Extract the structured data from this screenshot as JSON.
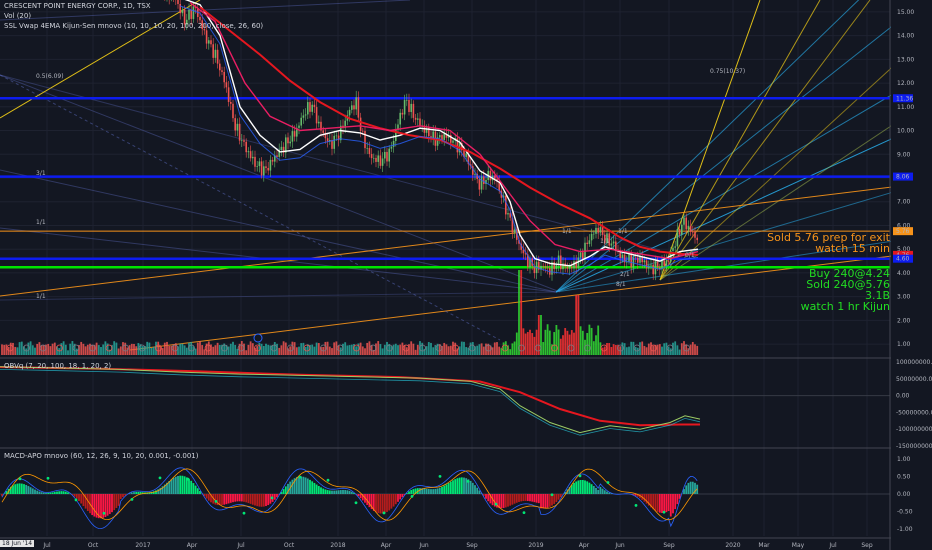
{
  "header": {
    "title": "CRESCENT POINT ENERGY CORP., 1D, TSX",
    "vol": "Vol (20)",
    "indicator": "SSL Vwap 4EMA Kijun-Sen mnovo (10, 10, 10, 20, 100, 200, close, 26, 60)"
  },
  "panes": {
    "obv": "OBVq (7, 20, 100, 18, 1, 20, 2)",
    "macd": "MACD-APO mnovo (60, 12, 26, 9, 10, 20, 0.001, -0.001)"
  },
  "annotations": [
    {
      "text": "Sold 5.76 prep for exit",
      "color": "#f7931a"
    },
    {
      "text": "watch 15 min",
      "color": "#f7931a"
    },
    {
      "text": "Buy 240@4.24",
      "color": "#22dd22"
    },
    {
      "text": "Sold 240@5.76",
      "color": "#22dd22"
    },
    {
      "text": "3.1B",
      "color": "#22dd22"
    },
    {
      "text": "watch 1 hr Kijun",
      "color": "#22dd22"
    }
  ],
  "fib_labels": [
    "0.75(10.37)",
    "0.5(6.09)",
    "3/1",
    "1/1",
    "1/1",
    "1/1",
    "1/1",
    "0/1",
    "2/1",
    "8/1",
    "1/1"
  ],
  "date_flag": "18 Jun '14",
  "colors": {
    "background": "#131722",
    "price": "#e0e0e0",
    "ma_red": "#e5171f",
    "ma_white": "#ffffff",
    "ma_magenta": "#e91e63",
    "ma_blue": "#2962ff",
    "blue_level": "#0d1cf0",
    "green_level": "#00e600",
    "orange": "#f7931a",
    "yellow": "#f5d016",
    "cyan": "#29b6f6"
  },
  "chart_data": [
    {
      "type": "line",
      "pane": "price",
      "x_ticks": [
        "Jul",
        "Oct",
        "2017",
        "Apr",
        "Jul",
        "Oct",
        "2018",
        "Apr",
        "Jun",
        "Sep",
        "2019",
        "Apr",
        "Jun",
        "Sep",
        "2020",
        "Mar",
        "May",
        "Jul",
        "Sep"
      ],
      "ylim": [
        0.5,
        15.5
      ],
      "y_ticks": [
        1.0,
        2.0,
        3.0,
        4.0,
        5.0,
        6.0,
        7.0,
        8.0,
        9.0,
        10.0,
        11.0,
        12.0,
        13.0,
        14.0,
        15.0
      ],
      "price_tags": [
        {
          "value": 11.36,
          "label": "11.36",
          "color": "#0d1cf0"
        },
        {
          "value": 8.06,
          "label": "8.06",
          "color": "#0d1cf0"
        },
        {
          "value": 5.76,
          "label": "5.76",
          "color": "#f7931a"
        },
        {
          "value": 4.76,
          "label": "4.76",
          "color": "#e5171f"
        },
        {
          "value": 4.6,
          "label": "4.60",
          "color": "#0d1cf0"
        }
      ],
      "levels": [
        {
          "value": 11.36,
          "color": "#0d1cf0"
        },
        {
          "value": 8.06,
          "color": "#0d1cf0"
        },
        {
          "value": 4.6,
          "color": "#0d1cf0"
        },
        {
          "value": 4.24,
          "color": "#00e600"
        },
        {
          "value": 5.76,
          "color": "#f7931a"
        }
      ],
      "price_series": [
        [
          0,
          18.5
        ],
        [
          30,
          17.8
        ],
        [
          60,
          17.0
        ],
        [
          90,
          16.6
        ],
        [
          120,
          16.4
        ],
        [
          150,
          16.2
        ],
        [
          175,
          15.6
        ],
        [
          185,
          14.6
        ],
        [
          195,
          15.2
        ],
        [
          205,
          14.0
        ],
        [
          215,
          13.2
        ],
        [
          225,
          12.0
        ],
        [
          235,
          10.2
        ],
        [
          245,
          9.3
        ],
        [
          255,
          8.6
        ],
        [
          265,
          8.3
        ],
        [
          275,
          8.9
        ],
        [
          285,
          9.4
        ],
        [
          295,
          9.9
        ],
        [
          305,
          10.8
        ],
        [
          312,
          11.1
        ],
        [
          320,
          10.1
        ],
        [
          330,
          9.4
        ],
        [
          340,
          9.9
        ],
        [
          350,
          10.9
        ],
        [
          356,
          11.2
        ],
        [
          362,
          9.8
        ],
        [
          370,
          8.9
        ],
        [
          380,
          8.7
        ],
        [
          390,
          9.1
        ],
        [
          400,
          10.6
        ],
        [
          406,
          11.3
        ],
        [
          414,
          10.6
        ],
        [
          425,
          10.0
        ],
        [
          435,
          9.6
        ],
        [
          445,
          9.8
        ],
        [
          455,
          9.5
        ],
        [
          465,
          9.0
        ],
        [
          472,
          8.3
        ],
        [
          480,
          7.7
        ],
        [
          488,
          8.1
        ],
        [
          495,
          8.0
        ],
        [
          502,
          7.2
        ],
        [
          510,
          6.2
        ],
        [
          518,
          5.3
        ],
        [
          526,
          4.6
        ],
        [
          534,
          4.2
        ],
        [
          542,
          4.3
        ],
        [
          550,
          4.1
        ],
        [
          558,
          4.5
        ],
        [
          566,
          4.2
        ],
        [
          574,
          4.3
        ],
        [
          582,
          4.8
        ],
        [
          590,
          5.5
        ],
        [
          598,
          5.9
        ],
        [
          606,
          5.4
        ],
        [
          614,
          5.2
        ],
        [
          622,
          4.6
        ],
        [
          630,
          4.5
        ],
        [
          640,
          4.6
        ],
        [
          650,
          4.2
        ],
        [
          660,
          4.3
        ],
        [
          668,
          4.5
        ],
        [
          676,
          5.4
        ],
        [
          683,
          6.2
        ],
        [
          690,
          5.8
        ],
        [
          698,
          5.4
        ]
      ],
      "moving_averages": [
        {
          "name": "",
          "color": "#ffffff",
          "points": [
            [
              180,
              15.6
            ],
            [
              200,
              15.3
            ],
            [
              220,
              14.0
            ],
            [
              240,
              11.0
            ],
            [
              260,
              9.8
            ],
            [
              280,
              9.1
            ],
            [
              300,
              9.2
            ],
            [
              320,
              9.8
            ],
            [
              340,
              10.0
            ],
            [
              360,
              9.9
            ],
            [
              380,
              9.6
            ],
            [
              400,
              9.8
            ],
            [
              420,
              10.1
            ],
            [
              440,
              10.0
            ],
            [
              460,
              9.5
            ],
            [
              480,
              8.3
            ],
            [
              500,
              7.8
            ],
            [
              510,
              7.0
            ],
            [
              520,
              5.6
            ],
            [
              535,
              4.6
            ],
            [
              550,
              4.4
            ],
            [
              570,
              4.3
            ],
            [
              590,
              4.7
            ],
            [
              605,
              5.1
            ],
            [
              620,
              4.9
            ],
            [
              640,
              4.7
            ],
            [
              660,
              4.5
            ],
            [
              680,
              4.9
            ],
            [
              698,
              5.0
            ]
          ]
        },
        {
          "name": "",
          "color": "#e5171f",
          "points": [
            [
              200,
              15.2
            ],
            [
              230,
              14.2
            ],
            [
              260,
              13.2
            ],
            [
              290,
              12.1
            ],
            [
              320,
              11.2
            ],
            [
              350,
              10.5
            ],
            [
              380,
              10.1
            ],
            [
              410,
              9.8
            ],
            [
              440,
              9.6
            ],
            [
              470,
              9.1
            ],
            [
              500,
              8.4
            ],
            [
              530,
              7.6
            ],
            [
              560,
              6.9
            ],
            [
              590,
              6.3
            ],
            [
              620,
              5.5
            ],
            [
              640,
              5.1
            ],
            [
              660,
              4.9
            ],
            [
              680,
              4.8
            ],
            [
              698,
              4.76
            ]
          ]
        },
        {
          "name": "",
          "color": "#e91e63",
          "points": [
            [
              190,
              15.4
            ],
            [
              215,
              14.6
            ],
            [
              245,
              12.0
            ],
            [
              270,
              10.6
            ],
            [
              300,
              10.0
            ],
            [
              330,
              10.1
            ],
            [
              360,
              10.2
            ],
            [
              390,
              10.0
            ],
            [
              420,
              10.2
            ],
            [
              450,
              10.0
            ],
            [
              480,
              9.0
            ],
            [
              505,
              7.6
            ],
            [
              530,
              6.2
            ],
            [
              555,
              5.2
            ],
            [
              580,
              4.9
            ],
            [
              610,
              5.0
            ],
            [
              640,
              4.8
            ],
            [
              670,
              4.6
            ],
            [
              698,
              4.9
            ]
          ]
        }
      ]
    },
    {
      "type": "line",
      "pane": "OBV",
      "ylim": [
        -150000000,
        100000000
      ],
      "y_ticks": [
        100000000,
        50000000,
        0,
        -50000000,
        -100000000,
        -150000000
      ],
      "series": [
        {
          "name": "",
          "color": "#e5171f",
          "points": [
            [
              0,
              85000000
            ],
            [
              100,
              80000000
            ],
            [
              200,
              72000000
            ],
            [
              300,
              62000000
            ],
            [
              400,
              55000000
            ],
            [
              480,
              42000000
            ],
            [
              520,
              10000000
            ],
            [
              560,
              -40000000
            ],
            [
              600,
              -75000000
            ],
            [
              640,
              -88000000
            ],
            [
              680,
              -86000000
            ],
            [
              700,
              -86000000
            ]
          ]
        },
        {
          "name": "",
          "color": "#9ccc65",
          "points": [
            [
              0,
              86000000
            ],
            [
              60,
              82000000
            ],
            [
              120,
              78000000
            ],
            [
              180,
              70000000
            ],
            [
              240,
              64000000
            ],
            [
              300,
              60000000
            ],
            [
              360,
              56000000
            ],
            [
              420,
              52000000
            ],
            [
              470,
              43000000
            ],
            [
              500,
              20000000
            ],
            [
              520,
              -30000000
            ],
            [
              550,
              -80000000
            ],
            [
              580,
              -110000000
            ],
            [
              610,
              -90000000
            ],
            [
              640,
              -100000000
            ],
            [
              670,
              -80000000
            ],
            [
              685,
              -60000000
            ],
            [
              700,
              -70000000
            ]
          ]
        }
      ]
    },
    {
      "type": "bar",
      "pane": "MACD-APO",
      "ylim": [
        -1.2,
        1.2
      ],
      "y_ticks": [
        1.0,
        0.5,
        0.0,
        -0.5,
        -1.0
      ]
    }
  ]
}
